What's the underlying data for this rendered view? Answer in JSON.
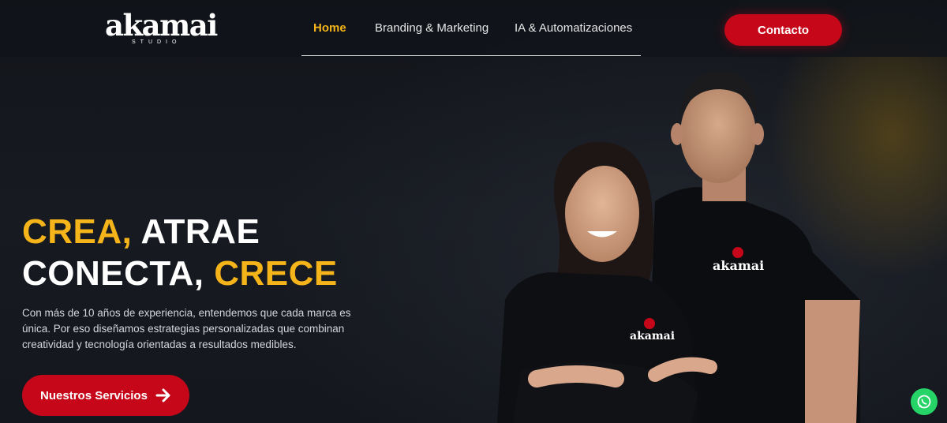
{
  "header": {
    "logo": {
      "word": "akamai",
      "sub": "STUDIO"
    },
    "nav": [
      {
        "label": "Home",
        "active": true
      },
      {
        "label": "Branding & Marketing",
        "active": false
      },
      {
        "label": "IA & Automatizaciones",
        "active": false
      }
    ],
    "contact_label": "Contacto"
  },
  "hero": {
    "line1_a": "CREA,",
    "line1_b": "ATRAE",
    "line2_a": "CONECTA,",
    "line2_b": "CRECE",
    "description": "Con más de 10 años de experiencia, entendemos que cada marca es única. Por eso diseñamos estrategias personalizadas que combinan creatividad y tecnología orientadas a resultados medibles.",
    "cta_label": "Nuestros Servicios",
    "shirt_logo": "akamai"
  },
  "colors": {
    "accent_yellow": "#f4b41a",
    "brand_red": "#c6071a",
    "background": "#13161c",
    "whatsapp_green": "#25d366"
  },
  "icons": [
    "arrow-right-icon",
    "whatsapp-icon"
  ]
}
